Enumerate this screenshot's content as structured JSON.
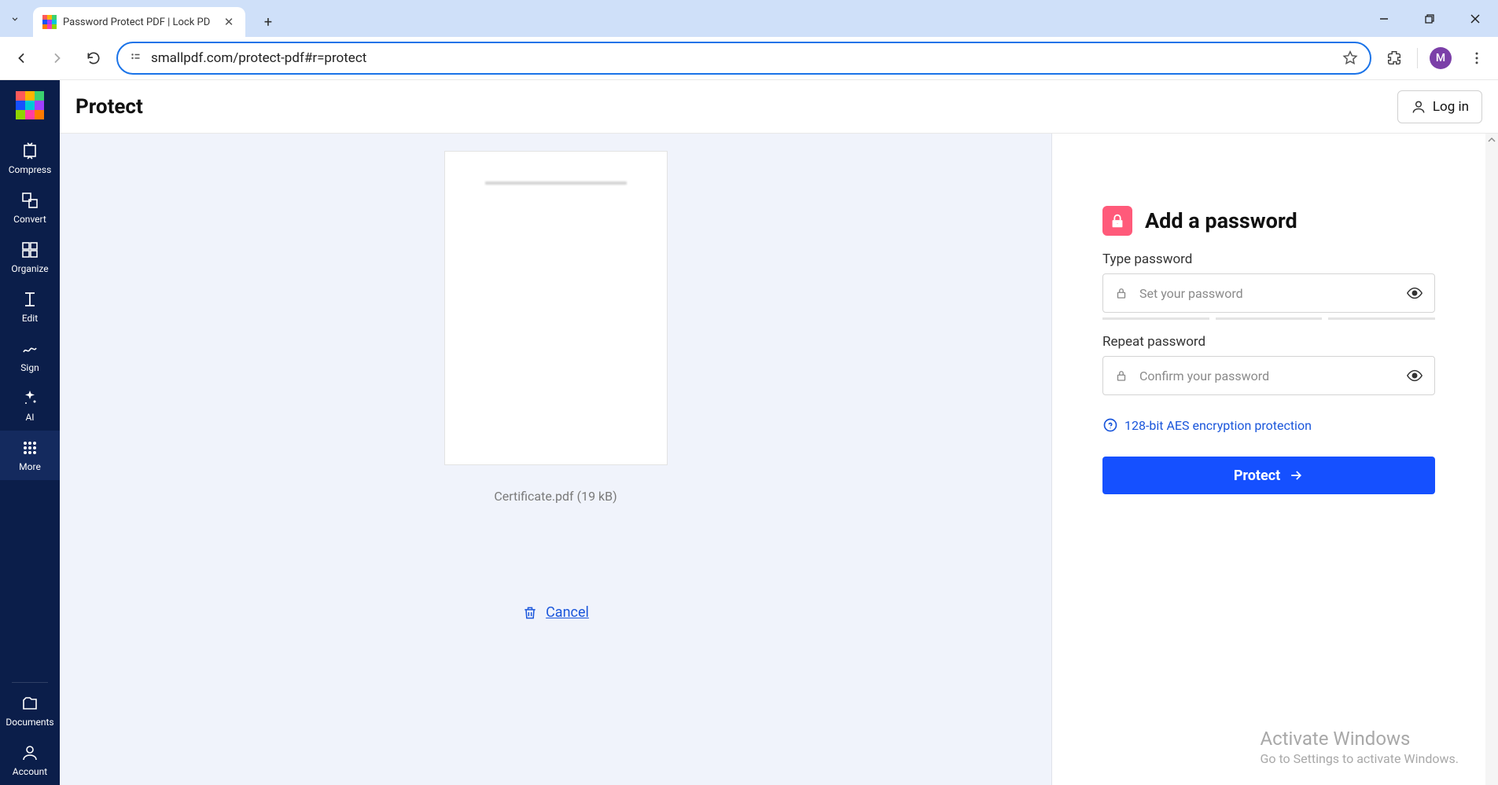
{
  "browser": {
    "tab_title": "Password Protect PDF | Lock PD",
    "url": "smallpdf.com/protect-pdf#r=protect",
    "profile_initial": "M"
  },
  "sidebar": {
    "items": [
      {
        "label": "Compress"
      },
      {
        "label": "Convert"
      },
      {
        "label": "Organize"
      },
      {
        "label": "Edit"
      },
      {
        "label": "Sign"
      },
      {
        "label": "AI"
      },
      {
        "label": "More"
      },
      {
        "label": "Documents"
      },
      {
        "label": "Account"
      }
    ]
  },
  "header": {
    "title": "Protect",
    "login_label": "Log in"
  },
  "preview": {
    "filename": "Certificate.pdf",
    "filesize": "(19 kB)",
    "cancel_label": "Cancel"
  },
  "panel": {
    "heading": "Add a password",
    "type_label": "Type password",
    "type_placeholder": "Set your password",
    "repeat_label": "Repeat password",
    "repeat_placeholder": "Confirm your password",
    "info_text": "128-bit AES encryption protection",
    "button_label": "Protect"
  },
  "watermark": {
    "line1": "Activate Windows",
    "line2": "Go to Settings to activate Windows."
  }
}
